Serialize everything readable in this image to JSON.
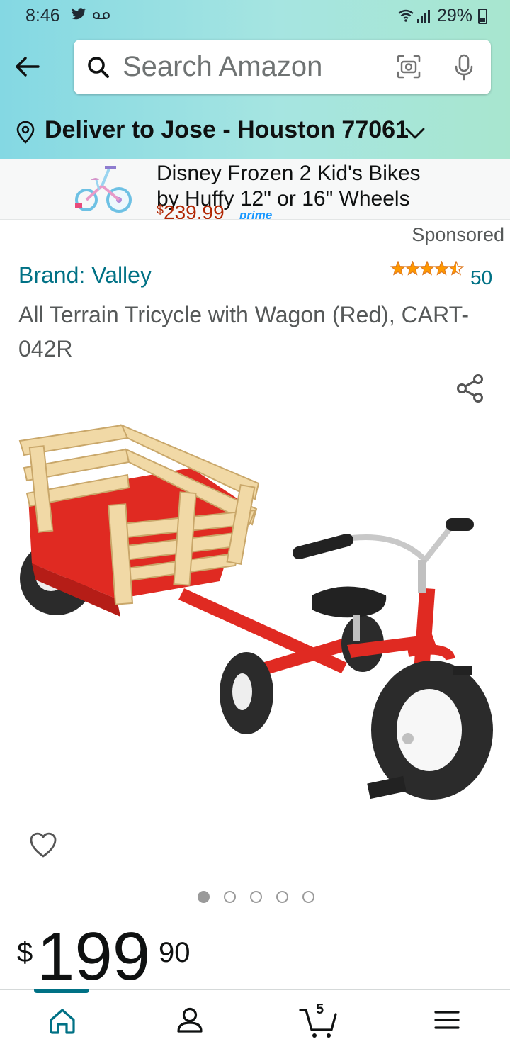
{
  "status_bar": {
    "time": "8:46",
    "battery": "29%"
  },
  "search": {
    "placeholder": "Search Amazon"
  },
  "delivery": {
    "label": "Deliver to Jose - Houston 77061"
  },
  "ad_banner": {
    "title": "Disney Frozen 2 Kid's Bikes",
    "subtitle": "by Huffy 12\" or 16\" Wheels",
    "price_currency": "$",
    "price": "239.99",
    "prime": "prime"
  },
  "product": {
    "sponsored_label": "Sponsored",
    "brand": "Brand: Valley",
    "rating_count": "50",
    "title": "All Terrain Tricycle with Wagon (Red), CART-042R",
    "image_count": 5,
    "active_image": 1,
    "price_currency": "$",
    "price_whole": "199",
    "price_fraction": "90"
  },
  "bottom_nav": {
    "cart_count": "5",
    "items": [
      "home-icon",
      "account-icon",
      "cart-icon",
      "menu-icon"
    ]
  },
  "colors": {
    "link": "#007185",
    "price_red": "#b12704",
    "star": "#ff9900",
    "header_gradient_start": "#84d8e3",
    "header_gradient_end": "#a8e6cf"
  }
}
